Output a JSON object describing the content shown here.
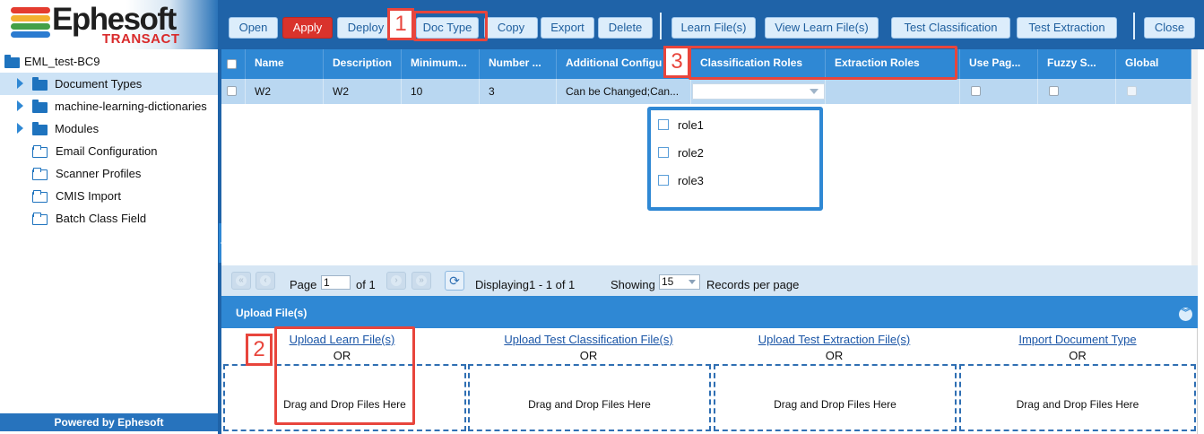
{
  "logo": {
    "word": "Ephesoft",
    "sub": "TRANSACT",
    "stripe_colors": [
      "#e43c2f",
      "#f3b02f",
      "#43a047",
      "#2b7bd0"
    ]
  },
  "tree": {
    "root_label": "EML_test-BC9",
    "items": [
      {
        "label": "Document Types",
        "icon": "folder-solid",
        "expandable": true,
        "selected": true
      },
      {
        "label": "machine-learning-dictionaries",
        "icon": "folder-solid",
        "expandable": true,
        "selected": false
      },
      {
        "label": "Modules",
        "icon": "folder-solid",
        "expandable": true,
        "selected": false
      },
      {
        "label": "Email Configuration",
        "icon": "folder-outline",
        "expandable": false,
        "selected": false
      },
      {
        "label": "Scanner Profiles",
        "icon": "folder-outline",
        "expandable": false,
        "selected": false
      },
      {
        "label": "CMIS Import",
        "icon": "folder-outline",
        "expandable": false,
        "selected": false
      },
      {
        "label": "Batch Class Field",
        "icon": "folder-outline",
        "expandable": false,
        "selected": false
      }
    ]
  },
  "footer": {
    "powered": "Powered by Ephesoft"
  },
  "toolbar": {
    "open": "Open",
    "apply": "Apply",
    "deploy": "Deploy",
    "doc_type": "Doc Type",
    "copy": "Copy",
    "export": "Export",
    "delete": "Delete",
    "learn_files": "Learn File(s)",
    "view_learn_files": "View Learn File(s)",
    "test_classification": "Test Classification",
    "test_extraction": "Test Extraction",
    "close": "Close"
  },
  "grid": {
    "columns": {
      "name": "Name",
      "description": "Description",
      "minimum": "Minimum...",
      "number": "Number ...",
      "additional": "Additional Configu",
      "classification_roles": "Classification Roles",
      "extraction_roles": "Extraction Roles",
      "use_page": "Use Pag...",
      "fuzzy": "Fuzzy S...",
      "global": "Global"
    },
    "row": {
      "name": "W2",
      "description": "W2",
      "minimum": "10",
      "number": "3",
      "additional": "Can be Changed;Can...",
      "classification_roles": "",
      "extraction_roles": "",
      "use_page": false,
      "fuzzy": false,
      "global": false
    },
    "role_options": [
      "role1",
      "role2",
      "role3"
    ]
  },
  "pager": {
    "page_label": "Page",
    "page_value": "1",
    "of_label": "of 1",
    "displaying": "Displaying1 - 1 of 1",
    "showing_label": "Showing",
    "page_size": "15",
    "records_label": "Records per page"
  },
  "upload": {
    "title": "Upload File(s)",
    "columns": [
      {
        "link": "Upload Learn File(s)",
        "or": "OR",
        "drop": "Drag and Drop Files Here"
      },
      {
        "link": "Upload Test Classification File(s)",
        "or": "OR",
        "drop": "Drag and Drop Files Here"
      },
      {
        "link": "Upload Test Extraction File(s)",
        "or": "OR",
        "drop": "Drag and Drop Files Here"
      },
      {
        "link": "Import Document Type",
        "or": "OR",
        "drop": "Drag and Drop Files Here"
      }
    ]
  },
  "annotations": {
    "badge1": "1",
    "badge2": "2",
    "badge3": "3"
  }
}
